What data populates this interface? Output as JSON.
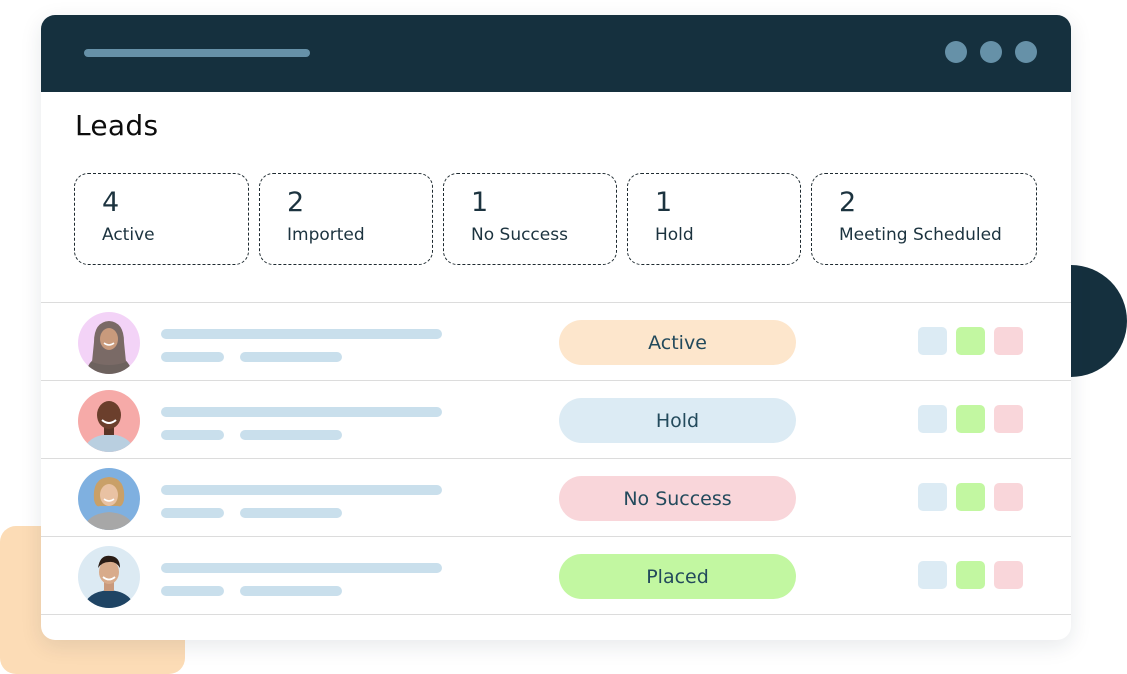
{
  "colors": {
    "titlebar": "#15303e",
    "titlebar_accent": "#6691a8",
    "skeleton": "#c9dfec",
    "status": {
      "Active": "#fde6cc",
      "Hold": "#dcebf4",
      "No Success": "#f9d6da",
      "Placed": "#c2f7a1"
    },
    "actions": [
      "#dcebf4",
      "#c2f7a1",
      "#f9d6da"
    ]
  },
  "page": {
    "title": "Leads"
  },
  "stats": [
    {
      "count": "4",
      "label": "Active"
    },
    {
      "count": "2",
      "label": "Imported"
    },
    {
      "count": "1",
      "label": "No Success"
    },
    {
      "count": "1",
      "label": "Hold"
    },
    {
      "count": "2",
      "label": "Meeting Scheduled"
    }
  ],
  "leads": [
    {
      "avatar": "woman-hijab-avatar",
      "status": "Active"
    },
    {
      "avatar": "man-bald-avatar",
      "status": "Hold"
    },
    {
      "avatar": "woman-blonde-avatar",
      "status": "No Success"
    },
    {
      "avatar": "man-dark-hair-avatar",
      "status": "Placed"
    }
  ]
}
